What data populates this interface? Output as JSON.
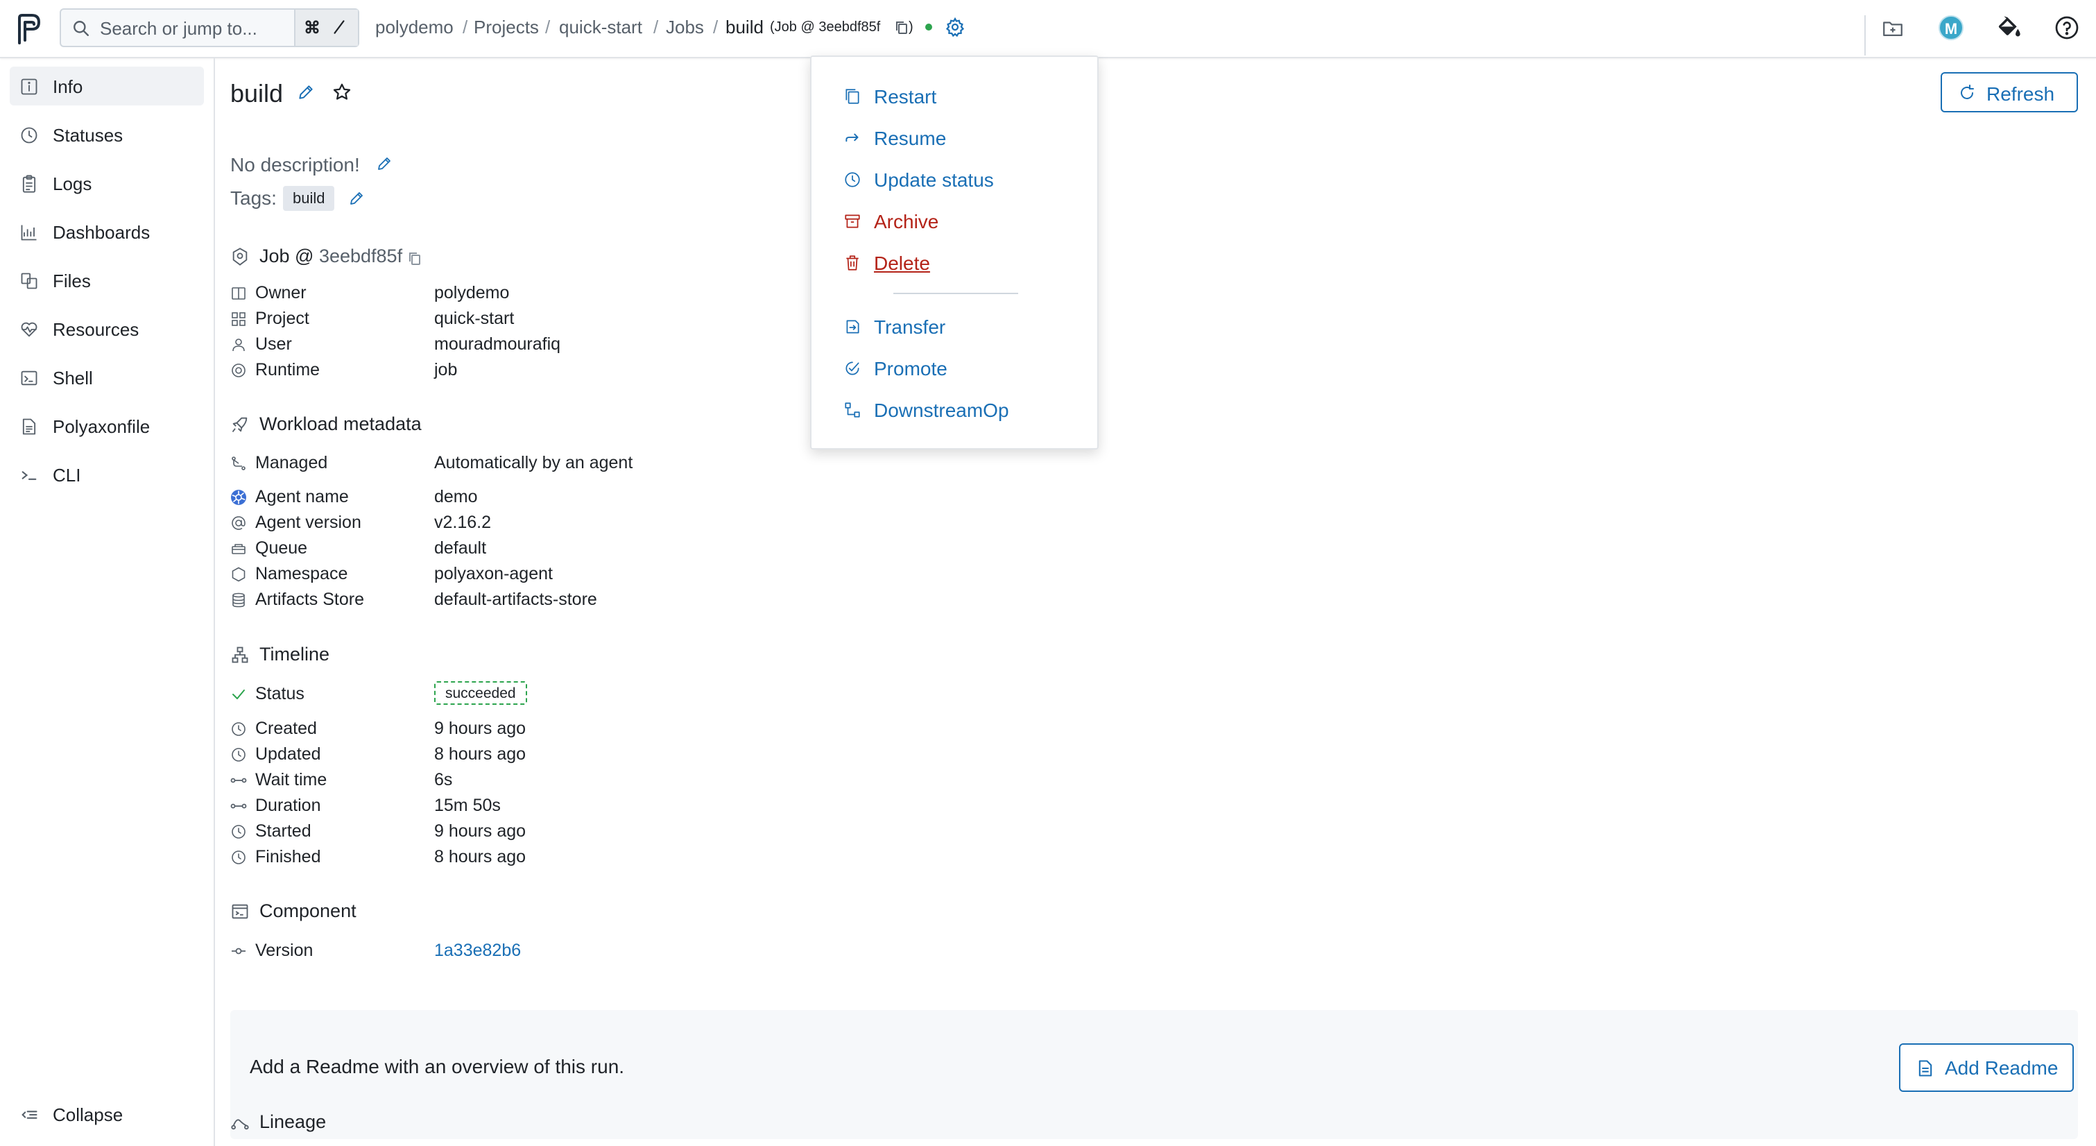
{
  "search": {
    "placeholder": "Search or jump to...",
    "shortcut_key": "⌘",
    "shortcut_slash": "/"
  },
  "breadcrumb": {
    "items": [
      "polydemo",
      "Projects",
      "quick-start",
      "Jobs"
    ],
    "current": "build",
    "current_sub": "(Job @ 3eebdf85f",
    "current_sub_close": ")"
  },
  "user": {
    "avatar_initial": "M"
  },
  "sidebar": {
    "items": [
      {
        "label": "Info",
        "icon": "info-icon"
      },
      {
        "label": "Statuses",
        "icon": "clock-icon"
      },
      {
        "label": "Logs",
        "icon": "clipboard-icon"
      },
      {
        "label": "Dashboards",
        "icon": "chart-icon"
      },
      {
        "label": "Files",
        "icon": "files-icon"
      },
      {
        "label": "Resources",
        "icon": "heartbeat-icon"
      },
      {
        "label": "Shell",
        "icon": "terminal-icon"
      },
      {
        "label": "Polyaxonfile",
        "icon": "file-icon"
      },
      {
        "label": "CLI",
        "icon": "cli-icon"
      }
    ],
    "collapse_label": "Collapse"
  },
  "page": {
    "title": "build",
    "refresh_label": "Refresh",
    "description": "No description!",
    "tags_label": "Tags:",
    "tags": [
      "build"
    ]
  },
  "job_section": {
    "prefix": "Job @ ",
    "uuid": "3eebdf85f"
  },
  "details": [
    {
      "label": "Owner",
      "value": "polydemo"
    },
    {
      "label": "Project",
      "value": "quick-start"
    },
    {
      "label": "User",
      "value": "mouradmourafiq"
    },
    {
      "label": "Runtime",
      "value": "job"
    }
  ],
  "workload": {
    "title": "Workload metadata",
    "managed_label": "Managed",
    "managed_value": "Automatically by an agent",
    "rows": [
      {
        "label": "Agent name",
        "value": "demo"
      },
      {
        "label": "Agent version",
        "value": "v2.16.2"
      },
      {
        "label": "Queue",
        "value": "default"
      },
      {
        "label": "Namespace",
        "value": "polyaxon-agent"
      },
      {
        "label": "Artifacts Store",
        "value": "default-artifacts-store"
      }
    ]
  },
  "timeline": {
    "title": "Timeline",
    "status_label": "Status",
    "status_value": "succeeded",
    "rows": [
      {
        "label": "Created",
        "value": "9 hours ago"
      },
      {
        "label": "Updated",
        "value": "8 hours ago"
      },
      {
        "label": "Wait time",
        "value": "6s"
      },
      {
        "label": "Duration",
        "value": "15m 50s"
      },
      {
        "label": "Started",
        "value": "9 hours ago"
      },
      {
        "label": "Finished",
        "value": "8 hours ago"
      }
    ]
  },
  "component": {
    "title": "Component",
    "version_label": "Version",
    "version_value": "1a33e82b6"
  },
  "readme": {
    "text": "Add a Readme with an overview of this run.",
    "button_label": "Add Readme"
  },
  "lineage": {
    "title": "Lineage"
  },
  "menu": {
    "items": [
      "Restart",
      "Resume",
      "Update status",
      "Archive",
      "Delete"
    ],
    "secondary_items": [
      "Transfer",
      "Promote",
      "DownstreamOp"
    ]
  },
  "colors": {
    "accent": "#1a6fb5",
    "danger": "#b42318",
    "success": "#2da44e"
  }
}
